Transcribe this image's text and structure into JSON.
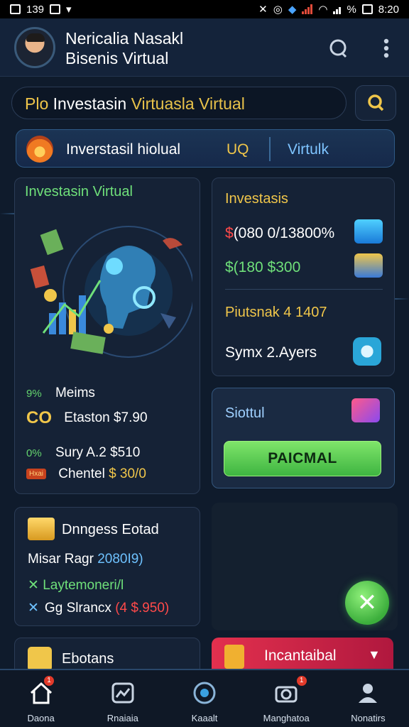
{
  "status_bar": {
    "left_text": "139",
    "battery": "%",
    "time": "8:20"
  },
  "header": {
    "title_line1": "Nericalia Nasakl",
    "title_line2": "Bisenis Virtual"
  },
  "search": {
    "part_a": "Plo",
    "part_b": "Investasin",
    "part_c": "Virtuasla Virtual"
  },
  "tabs": {
    "label_a": "Inverstasil hiolual",
    "label_b": "UQ",
    "label_c": "Virtulk"
  },
  "card_left": {
    "title": "Investasin Virtual",
    "rows": [
      {
        "tag": "9%",
        "text": "Meims"
      },
      {
        "tag": "CO",
        "text": "Etaston $7.90"
      },
      {
        "tag": "0%",
        "text": "Sury A.2 $510"
      },
      {
        "tag": "Hxai",
        "text": "Chentel",
        "value": "$ 30/0"
      }
    ]
  },
  "card_right_top": {
    "title": "Investasis",
    "value_red_symbol": "$",
    "value_red": "(080 0/13800%",
    "value_green": "$(180 $300",
    "value_yellow": "Piutsnak 4 1407",
    "value_white": "Symx 2.Ayers"
  },
  "card_right_mid": {
    "title": "Siottul",
    "button_label": "PAICMAL"
  },
  "card_left_lower": {
    "title": "Dnngess Eotad",
    "line1": "Misar Ragr",
    "line1_value": "2080I9)",
    "line2": "Laytemoneri/l",
    "line3_prefix": "Gg",
    "line3": "Slrancx",
    "line3_value": "(4 $.950)"
  },
  "card_bottom_left": {
    "title": "Ebotans"
  },
  "card_bottom_right": {
    "title": "Incantaibal"
  },
  "nav": [
    {
      "label": "Daona",
      "icon": "home-icon",
      "badge": "1"
    },
    {
      "label": "Rnaiaia",
      "icon": "chart-icon"
    },
    {
      "label": "Kaaalt",
      "icon": "compass-icon"
    },
    {
      "label": "Manghatoa",
      "icon": "camera-icon",
      "badge": "1"
    },
    {
      "label": "Nonatirs",
      "icon": "profile-icon"
    }
  ],
  "colors": {
    "accent_green": "#6fe07a",
    "accent_gold": "#f0c64a",
    "accent_red": "#ff4a4a",
    "accent_blue": "#7ec4ff",
    "bg": "#0f1b2c"
  }
}
